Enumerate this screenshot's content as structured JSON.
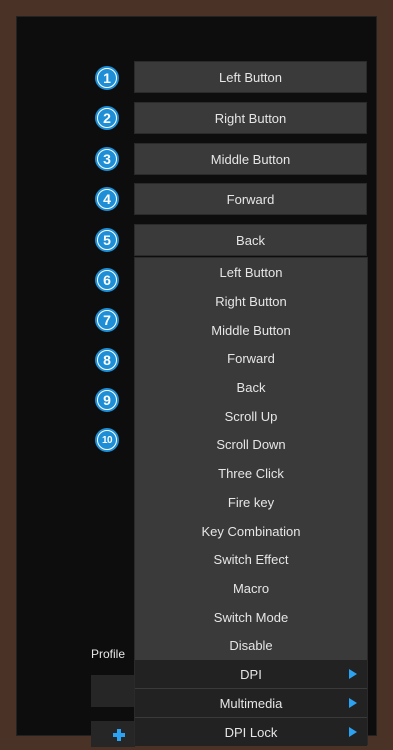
{
  "badges": [
    "1",
    "2",
    "3",
    "4",
    "5",
    "6",
    "7",
    "8",
    "9",
    "10"
  ],
  "buttons": [
    "Left Button",
    "Right Button",
    "Middle Button",
    "Forward",
    "Back"
  ],
  "dropdown": {
    "items": [
      "Left Button",
      "Right Button",
      "Middle Button",
      "Forward",
      "Back",
      "Scroll Up",
      "Scroll Down",
      "Three Click",
      "Fire key",
      "Key Combination",
      "Switch Effect",
      "Macro",
      "Switch Mode",
      "Disable"
    ],
    "submenus": [
      "DPI",
      "Multimedia",
      "DPI Lock"
    ]
  },
  "profile": {
    "label": "Profile"
  },
  "colors": {
    "accent": "#1e8fd6",
    "arrow": "#2ba3f2",
    "frame": "#4a3326"
  },
  "icons": {
    "add": "plus-icon",
    "submenu": "triangle-right-icon"
  }
}
